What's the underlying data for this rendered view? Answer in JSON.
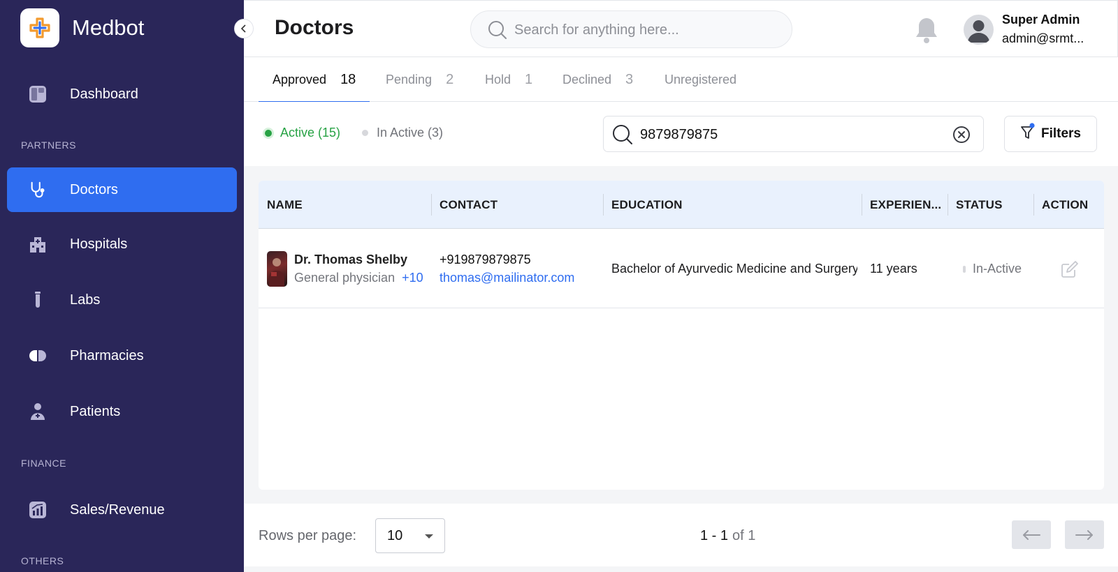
{
  "app": {
    "name": "Medbot"
  },
  "sidebar": {
    "dashboard": "Dashboard",
    "sections": {
      "partners": "PARTNERS",
      "finance": "FINANCE",
      "others": "OTHERS"
    },
    "items": [
      {
        "label": "Doctors",
        "icon": "stethoscope-icon",
        "active": true
      },
      {
        "label": "Hospitals",
        "icon": "hospital-icon"
      },
      {
        "label": "Labs",
        "icon": "test-tube-icon"
      },
      {
        "label": "Pharmacies",
        "icon": "pill-icon"
      },
      {
        "label": "Patients",
        "icon": "patient-icon"
      }
    ],
    "finance_items": [
      {
        "label": "Sales/Revenue",
        "icon": "chart-icon"
      }
    ]
  },
  "header": {
    "title": "Doctors",
    "search_placeholder": "Search for anything here...",
    "user_name": "Super Admin",
    "user_email": "admin@srmt..."
  },
  "tabs": [
    {
      "label": "Approved",
      "count": "18",
      "active": true
    },
    {
      "label": "Pending",
      "count": "2"
    },
    {
      "label": "Hold",
      "count": "1"
    },
    {
      "label": "Declined",
      "count": "3"
    },
    {
      "label": "Unregistered",
      "count": ""
    }
  ],
  "filters": {
    "active_label": "Active (15)",
    "inactive_label": "In Active (3)",
    "search_value": "9879879875",
    "filters_button": "Filters"
  },
  "table": {
    "columns": [
      "NAME",
      "CONTACT",
      "EDUCATION",
      "EXPERIEN...",
      "STATUS",
      "ACTION"
    ],
    "rows": [
      {
        "name": "Dr. Thomas Shelby",
        "specialty": "General physician",
        "more": "+10",
        "phone": "+919879879875",
        "email": "thomas@mailinator.com",
        "education": "Bachelor of Ayurvedic Medicine and Surgery",
        "experience": "11 years",
        "status": "In-Active"
      }
    ]
  },
  "pagination": {
    "rows_label": "Rows per page:",
    "rows_value": "10",
    "range": "1 - 1",
    "of": "of 1"
  },
  "colors": {
    "sidebar_bg": "#2a2659",
    "accent": "#2f6df0",
    "active_green": "#27a244",
    "table_header_bg": "#e9f1fd"
  }
}
